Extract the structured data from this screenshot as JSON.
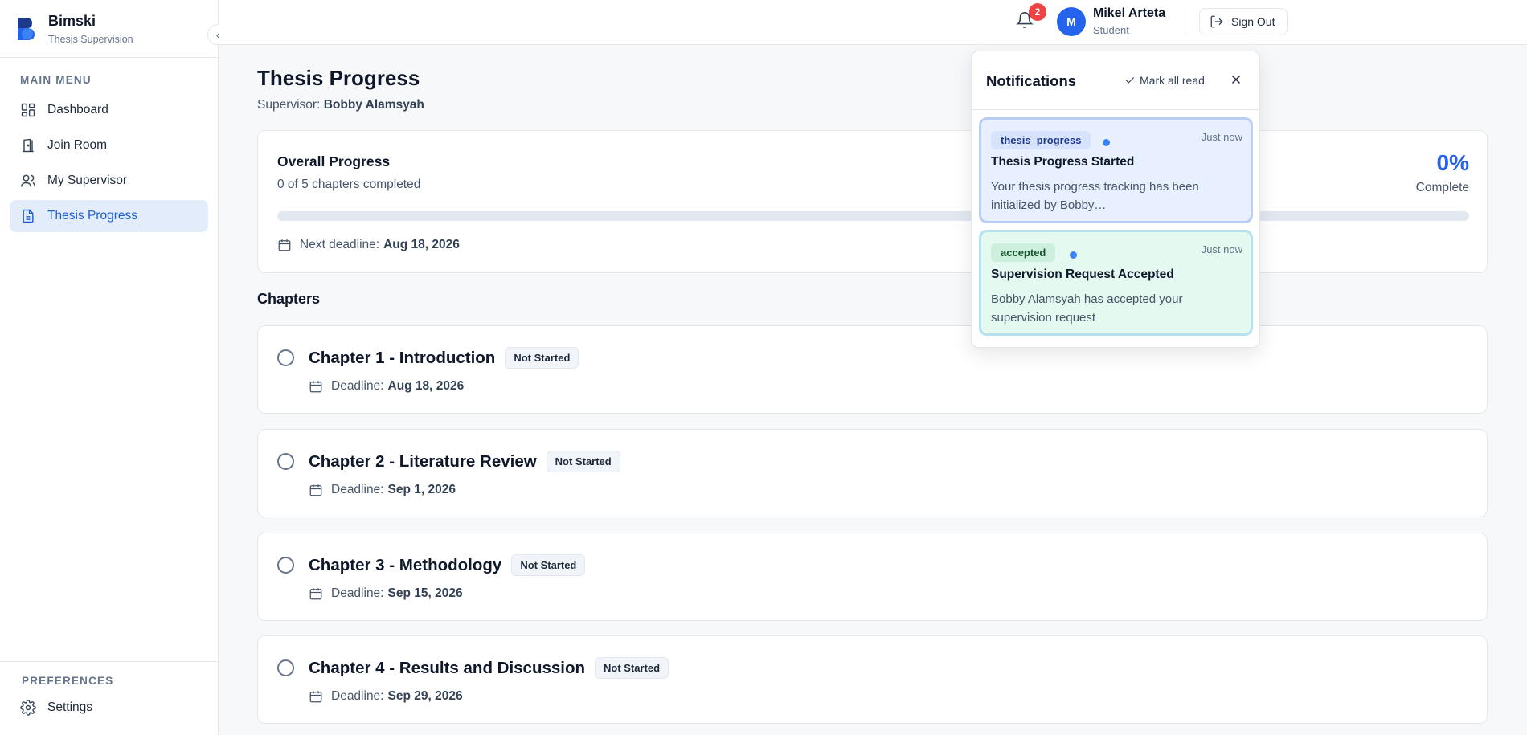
{
  "brand": {
    "name": "Bimski",
    "subtitle": "Thesis Supervision"
  },
  "sidebar": {
    "main_label": "MAIN MENU",
    "items": [
      {
        "label": "Dashboard",
        "icon": "dashboard-icon"
      },
      {
        "label": "Join Room",
        "icon": "door-icon"
      },
      {
        "label": "My Supervisor",
        "icon": "users-icon"
      },
      {
        "label": "Thesis Progress",
        "icon": "document-icon",
        "active": true
      }
    ],
    "prefs_label": "PREFERENCES",
    "settings_label": "Settings"
  },
  "header": {
    "notification_count": "2",
    "avatar_initial": "M",
    "user_name": "Mikel Arteta",
    "user_role": "Student",
    "sign_out": "Sign Out"
  },
  "page": {
    "title": "Thesis Progress",
    "supervisor_prefix": "Supervisor:",
    "supervisor_name": "Bobby Alamsyah"
  },
  "progress": {
    "title": "Overall Progress",
    "subtitle": "0 of 5 chapters completed",
    "percent_label": "0%",
    "percent_value": 0,
    "complete_label": "Complete",
    "deadline_prefix": "Next deadline:",
    "deadline_date": "Aug 18, 2026"
  },
  "chapters": {
    "label": "Chapters",
    "items": [
      {
        "title": "Chapter 1 - Introduction",
        "status": "Not Started",
        "deadline_prefix": "Deadline:",
        "deadline": "Aug 18, 2026"
      },
      {
        "title": "Chapter 2 - Literature Review",
        "status": "Not Started",
        "deadline_prefix": "Deadline:",
        "deadline": "Sep 1, 2026"
      },
      {
        "title": "Chapter 3 - Methodology",
        "status": "Not Started",
        "deadline_prefix": "Deadline:",
        "deadline": "Sep 15, 2026"
      },
      {
        "title": "Chapter 4 - Results and Discussion",
        "status": "Not Started",
        "deadline_prefix": "Deadline:",
        "deadline": "Sep 29, 2026"
      }
    ]
  },
  "notifications": {
    "title": "Notifications",
    "mark_all_read": "Mark all read",
    "items": [
      {
        "tag": "thesis_progress",
        "time": "Just now",
        "title": "Thesis Progress Started",
        "body": "Your thesis progress tracking has been initialized by Bobby…"
      },
      {
        "tag": "accepted",
        "time": "Just now",
        "title": "Supervision Request Accepted",
        "body": "Bobby Alamsyah has accepted your supervision request"
      }
    ]
  },
  "colors": {
    "accent": "#2563eb",
    "active_bg": "#e3ecfb",
    "badge_red": "#ef4444"
  }
}
